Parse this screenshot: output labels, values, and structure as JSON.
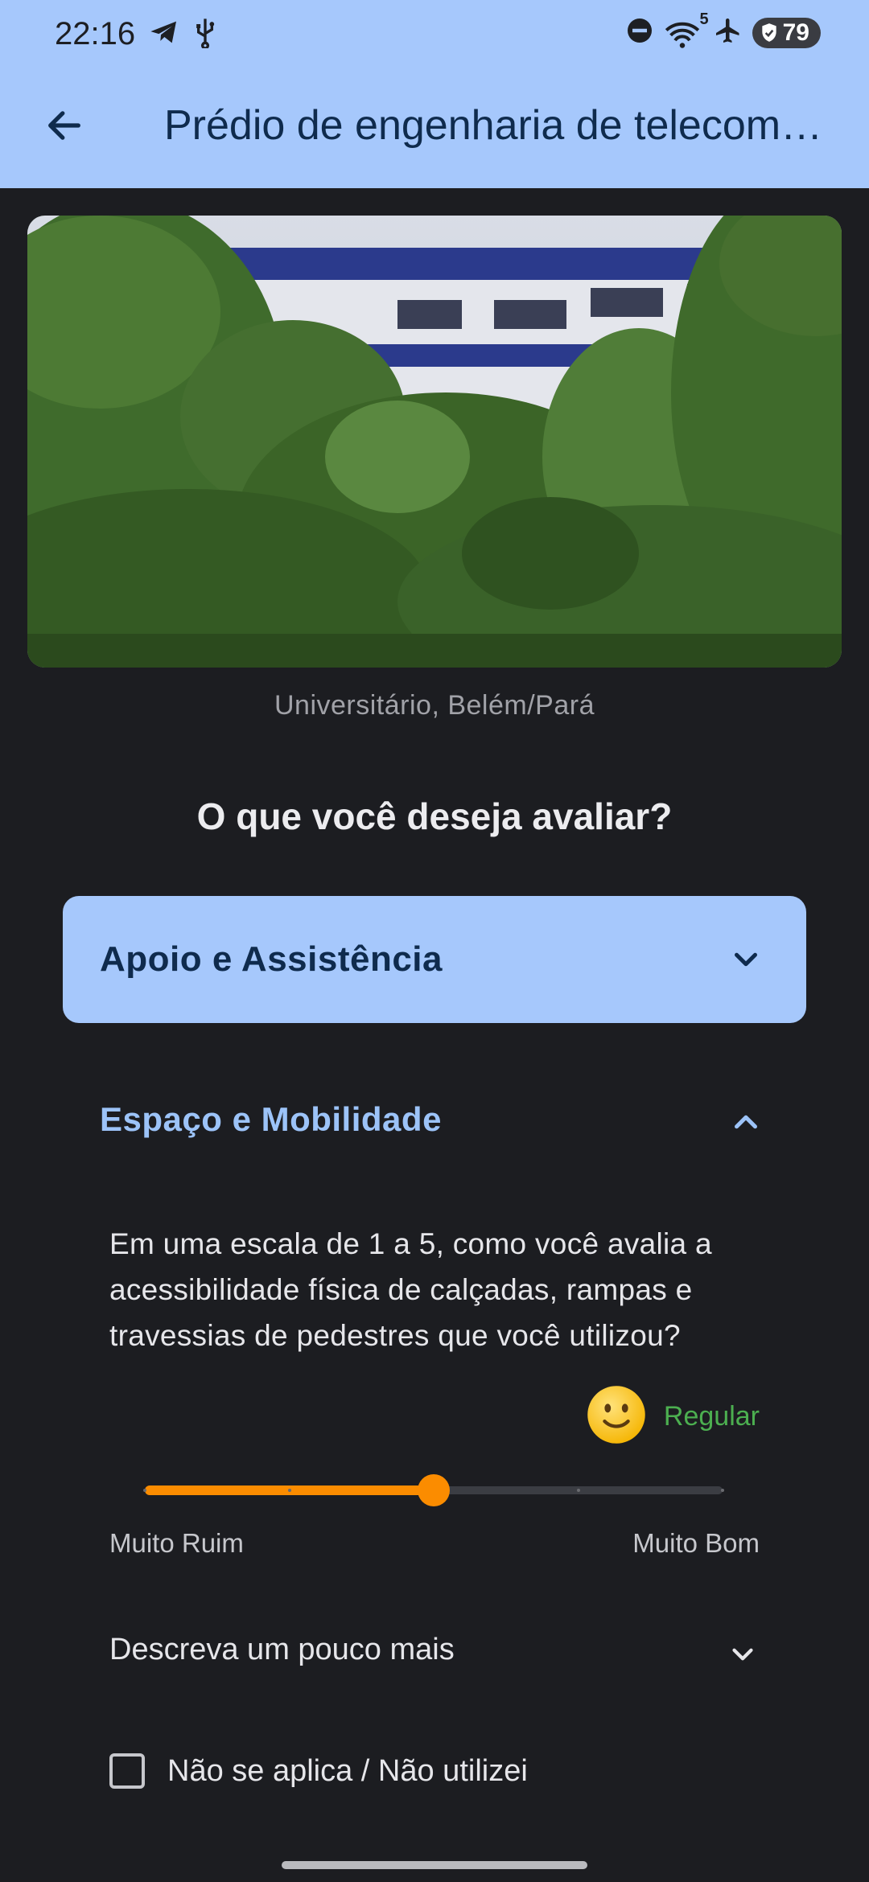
{
  "status_bar": {
    "time": "22:16",
    "battery": "79",
    "wifi_badge": "5",
    "left_icons": [
      "telegram-icon",
      "usb-icon"
    ],
    "right_icons": [
      "do-not-disturb-icon",
      "wifi-icon",
      "airplane-icon",
      "battery-icon"
    ]
  },
  "app_bar": {
    "title": "Prédio de engenharia de telecomunicações",
    "back_icon": "arrow-back-icon"
  },
  "hero": {
    "caption": "Universitário, Belém/Pará"
  },
  "main": {
    "heading": "O que você deseja avaliar?",
    "sections": [
      {
        "label": "Apoio e Assistência",
        "expanded": false
      },
      {
        "label": "Espaço e Mobilidade",
        "expanded": true
      }
    ],
    "question": "Em uma escala de 1 a 5, como você avalia a acessibilidade física de calçadas, rampas e travessias de pedestres que você utilizou?",
    "rating": {
      "emoji": "🙂",
      "label": "Regular",
      "value": 3,
      "min": 1,
      "max": 5,
      "min_label": "Muito Ruim",
      "max_label": "Muito Bom"
    },
    "describe_label": "Descreva um pouco mais",
    "not_applicable_label": "Não se aplica / Não utilizei",
    "not_applicable_checked": false
  },
  "colors": {
    "accent": "#a6c8fc",
    "slider": "#fb8c00",
    "rating_label": "#4caf50",
    "background": "#1c1d21"
  }
}
